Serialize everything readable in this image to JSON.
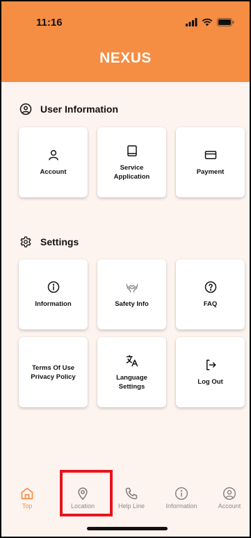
{
  "status": {
    "time": "11:16"
  },
  "app": {
    "title": "NEXUS"
  },
  "sections": {
    "user_info": {
      "title": "User Information"
    },
    "settings": {
      "title": "Settings"
    }
  },
  "cards": {
    "account": "Account",
    "service_application": "Service\nApplication",
    "payment": "Payment",
    "information": "Information",
    "safety_info": "Safety Info",
    "faq": "FAQ",
    "terms": "Terms Of Use\nPrivacy Policy",
    "language": "Language\nSettings",
    "logout": "Log Out"
  },
  "nav": {
    "top": "Top",
    "location": "Location",
    "help_line": "Help Line",
    "information": "Information",
    "account": "Account"
  },
  "colors": {
    "accent": "#f58d43",
    "background": "#fdf3ef",
    "highlight": "#e8141c"
  }
}
